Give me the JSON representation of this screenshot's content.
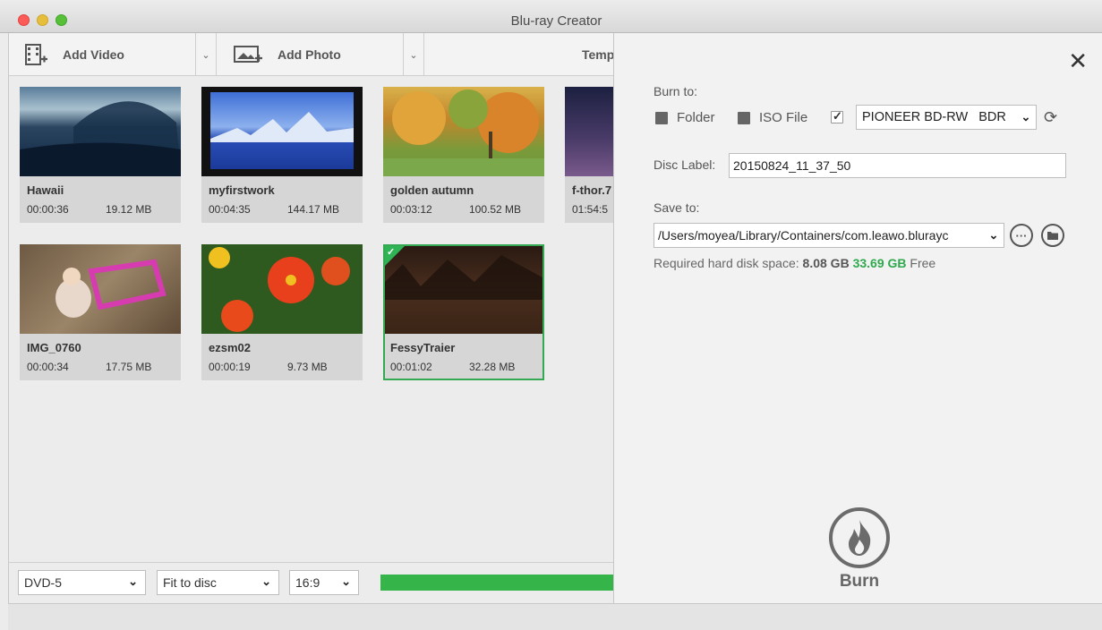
{
  "window": {
    "title": "Blu-ray Creator"
  },
  "toolbar": {
    "add_video": "Add Video",
    "add_photo": "Add Photo",
    "template": "Temp"
  },
  "videos": [
    {
      "name": "Hawaii",
      "duration": "00:00:36",
      "size": "19.12 MB"
    },
    {
      "name": "myfirstwork",
      "duration": "00:04:35",
      "size": "144.17 MB"
    },
    {
      "name": "golden autumn",
      "duration": "00:03:12",
      "size": "100.52 MB"
    },
    {
      "name": "f-thor.7",
      "duration": "01:54:5",
      "size": ""
    },
    {
      "name": "IMG_0760",
      "duration": "00:00:34",
      "size": "17.75 MB"
    },
    {
      "name": "ezsm02",
      "duration": "00:00:19",
      "size": "9.73 MB"
    },
    {
      "name": "FessyTraier",
      "duration": "00:01:02",
      "size": "32.28 MB"
    }
  ],
  "bottom": {
    "disc_type": "DVD-5",
    "fit_mode": "Fit to disc",
    "aspect": "16:9",
    "progress_fraction": 1.0
  },
  "burn_panel": {
    "burn_to_label": "Burn to:",
    "folder_label": "Folder",
    "iso_label": "ISO File",
    "drive": "PIONEER BD-RW   BDR",
    "disc_label_label": "Disc Label:",
    "disc_label_value": "20150824_11_37_50",
    "save_to_label": "Save to:",
    "save_path": "/Users/moyea/Library/Containers/com.leawo.blurayc",
    "required_label": "Required hard disk space:",
    "required_value": "8.08 GB",
    "free_value": "33.69 GB",
    "free_label": "Free",
    "burn_label": "Burn"
  },
  "colors": {
    "accent_green": "#35b44a",
    "selected_border": "#34a853"
  }
}
